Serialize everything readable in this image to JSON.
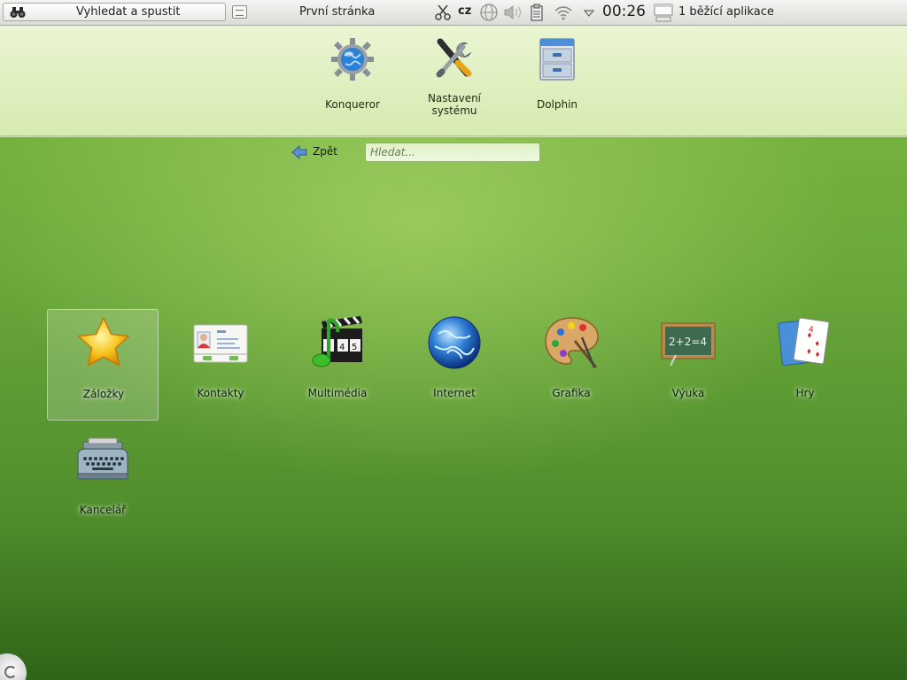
{
  "panel": {
    "launcher_label": "Vyhledat a spustit",
    "page_title": "První stránka",
    "language": "cz",
    "clock": "00:26",
    "tasks_label": "1 běžící aplikace"
  },
  "favorites": [
    {
      "label": "Konqueror",
      "icon": "konqueror-icon"
    },
    {
      "label": "Nastavení\nsystému",
      "icon": "system-settings-icon"
    },
    {
      "label": "Dolphin",
      "icon": "dolphin-icon"
    }
  ],
  "nav": {
    "back_label": "Zpět",
    "search_placeholder": "Hledat..."
  },
  "categories": [
    {
      "label": "Záložky",
      "icon": "bookmarks-star-icon",
      "selected": true
    },
    {
      "label": "Kontakty",
      "icon": "contacts-card-icon"
    },
    {
      "label": "Multimédia",
      "icon": "multimedia-icon"
    },
    {
      "label": "Internet",
      "icon": "globe-icon"
    },
    {
      "label": "Grafika",
      "icon": "palette-icon"
    },
    {
      "label": "Výuka",
      "icon": "chalkboard-icon"
    },
    {
      "label": "Hry",
      "icon": "playing-cards-icon"
    },
    {
      "label": "Kancelář",
      "icon": "typewriter-icon"
    }
  ],
  "colors": {
    "accent_green": "#6aa83a",
    "panel_bg": "#dcdcd8"
  }
}
